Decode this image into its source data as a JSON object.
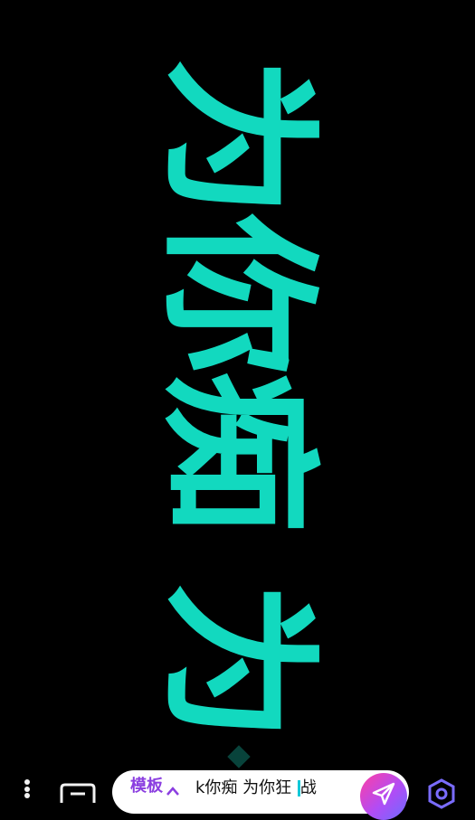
{
  "danmaku": {
    "scrolling_text": "为你痴 为"
  },
  "bottom_bar": {
    "template_label": "模板",
    "input_value": "k你痴 为你狂 ",
    "input_tail": "战"
  },
  "colors": {
    "text_accent": "#12d9bf",
    "background": "#000000",
    "template_label": "#8b3ee0"
  },
  "icons": {
    "more": "vertical-dots-icon",
    "bubble": "chat-bubble-icon",
    "chevron": "chevron-up-icon",
    "send": "send-icon",
    "hex": "hexagon-settings-icon"
  }
}
